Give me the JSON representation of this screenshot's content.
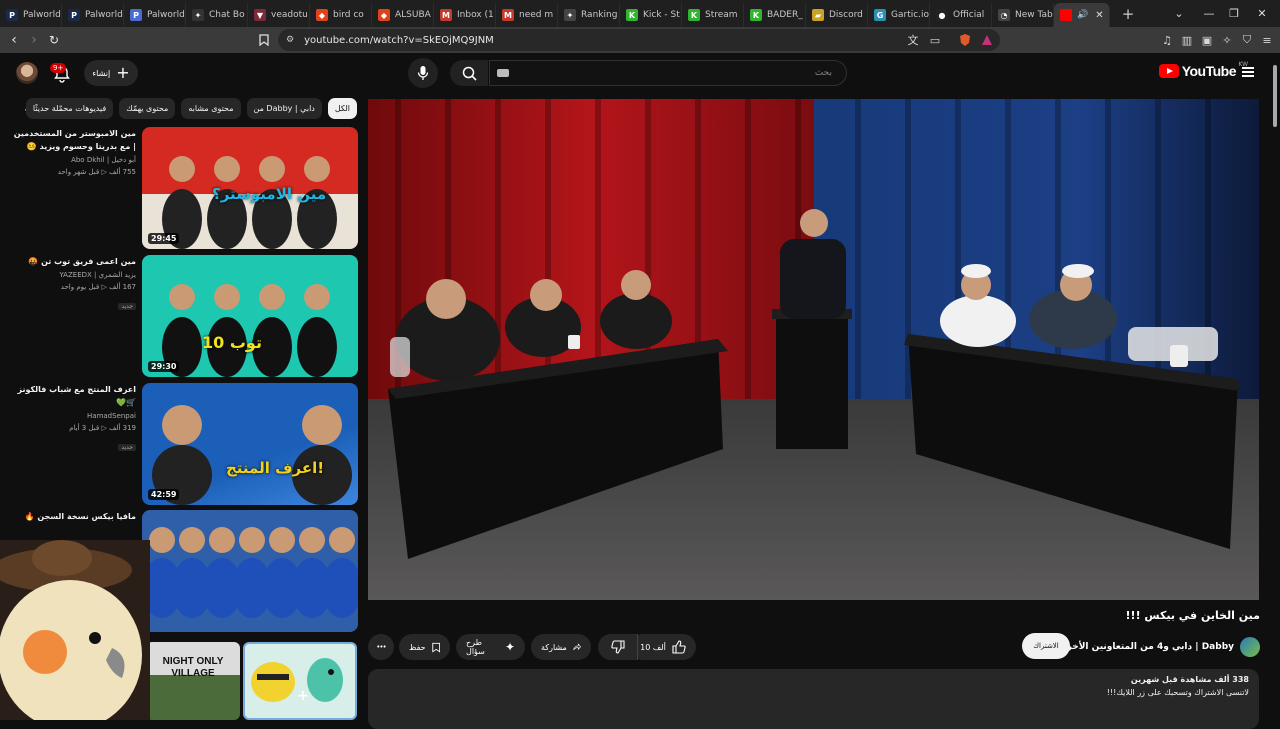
{
  "browser": {
    "tabs": [
      {
        "label": "Palworld",
        "fav": "P",
        "color": "#1a2a4a"
      },
      {
        "label": "Palworld",
        "fav": "P",
        "color": "#1a2a4a"
      },
      {
        "label": "Palworld",
        "fav": "P",
        "color": "#4a6bd6"
      },
      {
        "label": "Chat Bo",
        "fav": "✦",
        "color": "#333333"
      },
      {
        "label": "veadotu",
        "fav": "▼",
        "color": "#7a2a3a"
      },
      {
        "label": "bird co",
        "fav": "◆",
        "color": "#e0421b"
      },
      {
        "label": "ALSUBA",
        "fav": "◆",
        "color": "#e0421b"
      },
      {
        "label": "Inbox (1",
        "fav": "M",
        "color": "#c53a2b"
      },
      {
        "label": "need m",
        "fav": "M",
        "color": "#c53a2b"
      },
      {
        "label": "Ranking",
        "fav": "✦",
        "color": "#444444"
      },
      {
        "label": "Kick - St",
        "fav": "K",
        "color": "#2fb52f"
      },
      {
        "label": "Stream",
        "fav": "K",
        "color": "#2fb52f"
      },
      {
        "label": "BADER_",
        "fav": "K",
        "color": "#2fb52f"
      },
      {
        "label": "Discord",
        "fav": "▰",
        "color": "#c9a227"
      },
      {
        "label": "Gartic.io",
        "fav": "G",
        "color": "#2b8fb5"
      },
      {
        "label": "Official",
        "fav": "●",
        "color": "#222222"
      },
      {
        "label": "New Tab",
        "fav": "◔",
        "color": "#444444"
      }
    ],
    "active_tab_audio": "🔊",
    "close_glyph": "✕",
    "new_tab_glyph": "+",
    "url": "youtube.com/watch?v=SkEOjMQ9JNM"
  },
  "masthead": {
    "logo_text": "YouTube",
    "country": "KW",
    "search_placeholder": "بحث",
    "create_label": "إنشاء",
    "notification_count": "9+"
  },
  "chips": [
    {
      "label": "الكل",
      "selected": true
    },
    {
      "label": "من Dabby | دابي",
      "selected": false
    },
    {
      "label": "محتوى مشابه",
      "selected": false
    },
    {
      "label": "محتوى يهمّك",
      "selected": false
    },
    {
      "label": "فيديوهات محمّلة حديثًا",
      "selected": false
    }
  ],
  "recommendations": [
    {
      "title": "مين الامبوستر من المستخدمين | مع بدريتا وحسوم ويزيد 🤒",
      "channel": "أبو دخيل | Abo Dkhil",
      "stats": "755 ألف ▷ قبل شهر واحد",
      "duration": "29:45",
      "thumb_text": "مين الامبوستر؟",
      "is_new": false,
      "new_label": ""
    },
    {
      "title": "مين اعمى فريق توب تن 🤬",
      "channel": "يزيد الشمري | YAZEEDX",
      "stats": "167 ألف ▷ قبل يوم واحد",
      "duration": "29:30",
      "thumb_text": "توب 10",
      "is_new": true,
      "new_label": "جديد"
    },
    {
      "title": "اعرف المنتج مع شباب فالكونز 🛒💚",
      "channel": "HamadSenpai",
      "stats": "319 ألف ▷ قبل 3 أيام",
      "duration": "42:59",
      "thumb_text": "اعرف المنتج!",
      "is_new": true,
      "new_label": "جديد"
    },
    {
      "title": "مافيا بيكس نسخة السجن 🔥",
      "channel": "",
      "stats": "",
      "duration": "",
      "thumb_text": "",
      "is_new": false,
      "new_label": ""
    }
  ],
  "shorts": [
    {
      "label": "NIGHT ONLY VILLAGE"
    },
    {
      "label": ""
    }
  ],
  "video": {
    "title": "مين الخاين في بيكس !!!",
    "channel": "Dabby | دابي و4 من المتعاونين الأخرين",
    "subscribe_label": "الاشتراك",
    "likes": "10 ألف",
    "share_label": "مشاركة",
    "ask_label": "طرح سؤال",
    "save_label": "حفظ",
    "more_glyph": "•••",
    "desc_views": "338 ألف مشاهدة  قبل شهرين",
    "desc_text": "لاتنسى الاشتراك وتسحبك على زر اللايك!!!"
  }
}
